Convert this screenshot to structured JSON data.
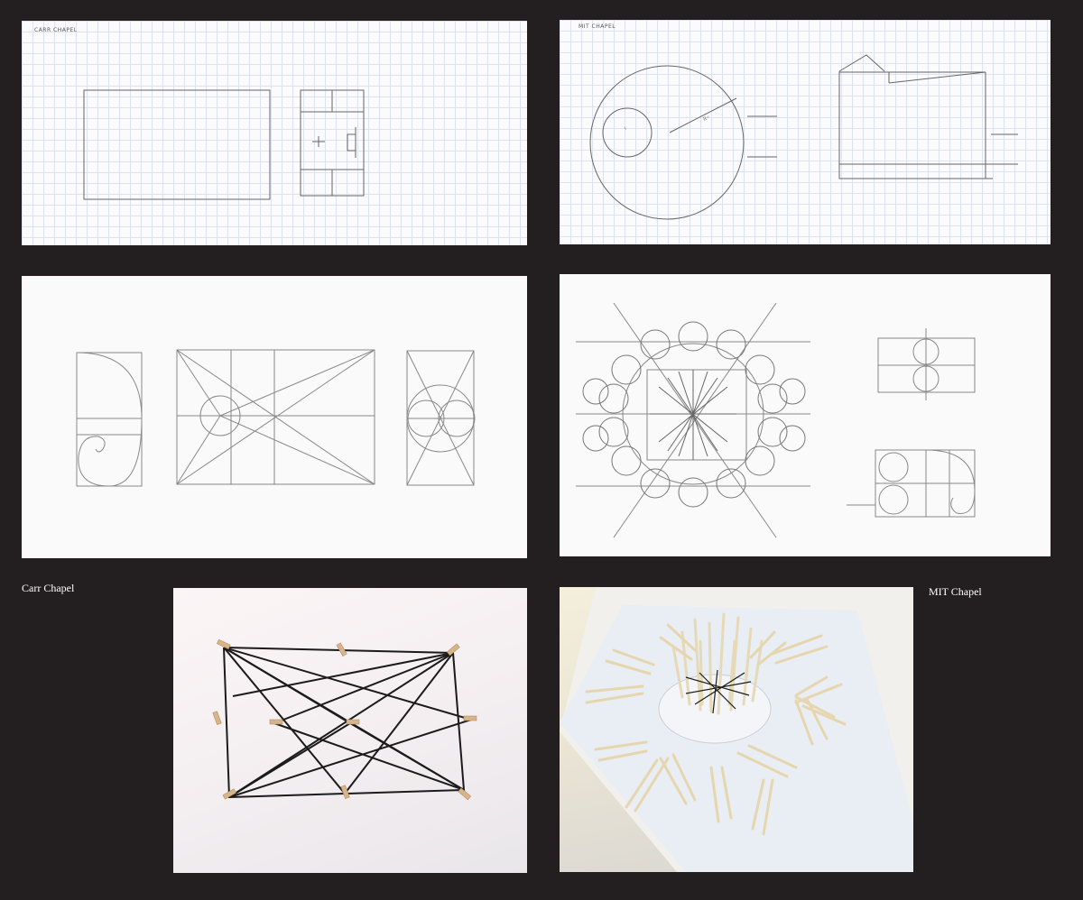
{
  "sketches": {
    "carr_plan_label": "CARR CHAPEL",
    "mit_plan_label": "MIT CHAPEL",
    "mit_radius_label": "R=",
    "mit_small_radius_label": "r"
  },
  "captions": {
    "carr": "Carr Chapel",
    "mit": "MIT Chapel"
  },
  "colors": {
    "background": "#231f20",
    "paper": "#fdfdfd",
    "pencil": "#555555",
    "caption_text": "#ffffff"
  }
}
